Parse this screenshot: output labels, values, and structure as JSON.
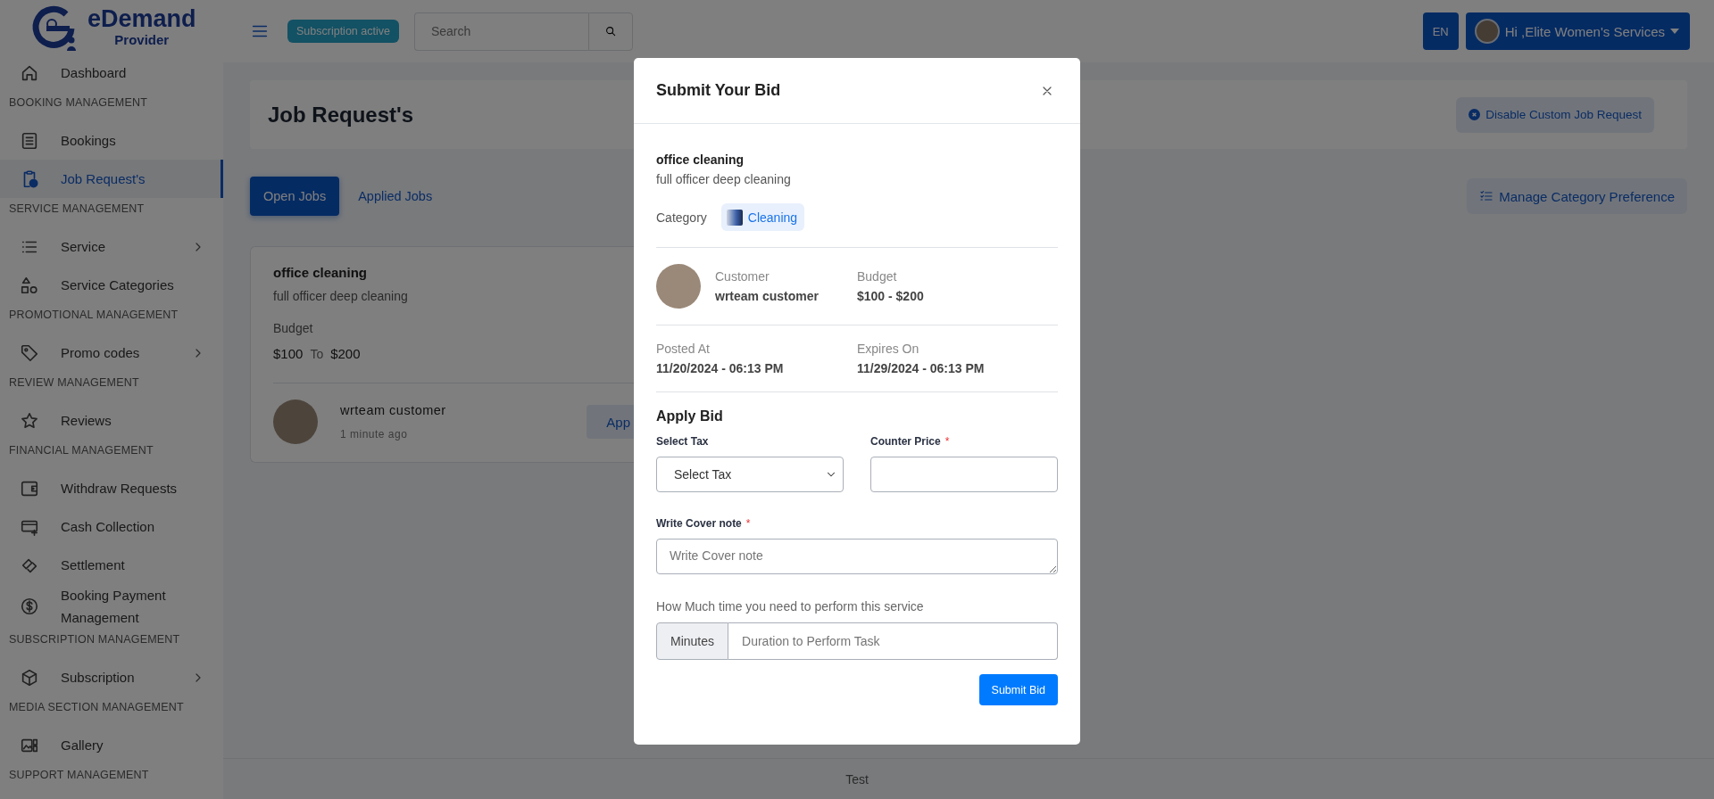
{
  "brand": {
    "name": "eDemand",
    "subtitle": "Provider"
  },
  "sidebar": {
    "items": [
      {
        "kind": "link",
        "label": "Dashboard",
        "selected": false,
        "submenu": false
      },
      {
        "kind": "heading",
        "label": "BOOKING MANAGEMENT"
      },
      {
        "kind": "link",
        "label": "Bookings",
        "selected": false,
        "submenu": false
      },
      {
        "kind": "link",
        "label": "Job Request's",
        "selected": true,
        "submenu": false
      },
      {
        "kind": "heading",
        "label": "SERVICE MANAGEMENT"
      },
      {
        "kind": "link",
        "label": "Service",
        "selected": false,
        "submenu": true
      },
      {
        "kind": "link",
        "label": "Service Categories",
        "selected": false,
        "submenu": false
      },
      {
        "kind": "heading",
        "label": "PROMOTIONAL MANAGEMENT"
      },
      {
        "kind": "link",
        "label": "Promo codes",
        "selected": false,
        "submenu": true
      },
      {
        "kind": "heading",
        "label": "REVIEW MANAGEMENT"
      },
      {
        "kind": "link",
        "label": "Reviews",
        "selected": false,
        "submenu": false
      },
      {
        "kind": "heading",
        "label": "FINANCIAL MANAGEMENT"
      },
      {
        "kind": "link",
        "label": "Withdraw Requests",
        "selected": false,
        "submenu": false
      },
      {
        "kind": "link",
        "label": "Cash Collection",
        "selected": false,
        "submenu": false
      },
      {
        "kind": "link",
        "label": "Settlement",
        "selected": false,
        "submenu": false
      },
      {
        "kind": "link",
        "label": "Booking Payment Management",
        "selected": false,
        "submenu": false
      },
      {
        "kind": "heading",
        "label": "SUBSCRIPTION MANAGEMENT"
      },
      {
        "kind": "link",
        "label": "Subscription",
        "selected": false,
        "submenu": true
      },
      {
        "kind": "heading",
        "label": "MEDIA SECTION MANAGEMENT"
      },
      {
        "kind": "link",
        "label": "Gallery",
        "selected": false,
        "submenu": false
      },
      {
        "kind": "heading",
        "label": "SUPPORT MANAGEMENT"
      }
    ]
  },
  "header": {
    "badge": "Subscription active",
    "search": {
      "placeholder": "Search"
    },
    "language": "EN",
    "user": "Hi ,Elite Women's Services"
  },
  "page": {
    "title": "Job Request's",
    "disable_button": "Disable Custom Job Request",
    "tabs": [
      {
        "label": "Open Jobs",
        "selected": true
      },
      {
        "label": "Applied Jobs",
        "selected": false
      }
    ],
    "manage_button": "Manage Category Preference",
    "job_card": {
      "title": "office cleaning",
      "description": "full officer deep cleaning",
      "budget_label": "Budget",
      "budget_min": "$100",
      "budget_to": "To",
      "budget_max": "$200",
      "customer": "wrteam customer",
      "time": "1 minute ago",
      "apply_button": "App"
    },
    "footer": "Test"
  },
  "modal": {
    "title": "Submit Your Bid",
    "job_title": "office cleaning",
    "job_description": "full officer deep cleaning",
    "category_label": "Category",
    "category": "Cleaning",
    "customer_label": "Customer",
    "customer": "wrteam customer",
    "budget_label": "Budget",
    "budget": "$100 - $200",
    "posted_label": "Posted At",
    "posted": "11/20/2024 - 06:13 PM",
    "expires_label": "Expires On",
    "expires": "11/29/2024 - 06:13 PM",
    "section": "Apply Bid",
    "tax": {
      "label": "Select Tax",
      "value": "Select Tax"
    },
    "counter_price": {
      "label": "Counter Price",
      "required_mark": "*"
    },
    "cover_note": {
      "label": "Write Cover note",
      "required_mark": "*",
      "placeholder": "Write Cover note"
    },
    "duration_hint": "How Much time you need to perform this service",
    "duration": {
      "unit": "Minutes",
      "placeholder": "Duration to Perform Task"
    },
    "submit": "Submit Bid"
  }
}
